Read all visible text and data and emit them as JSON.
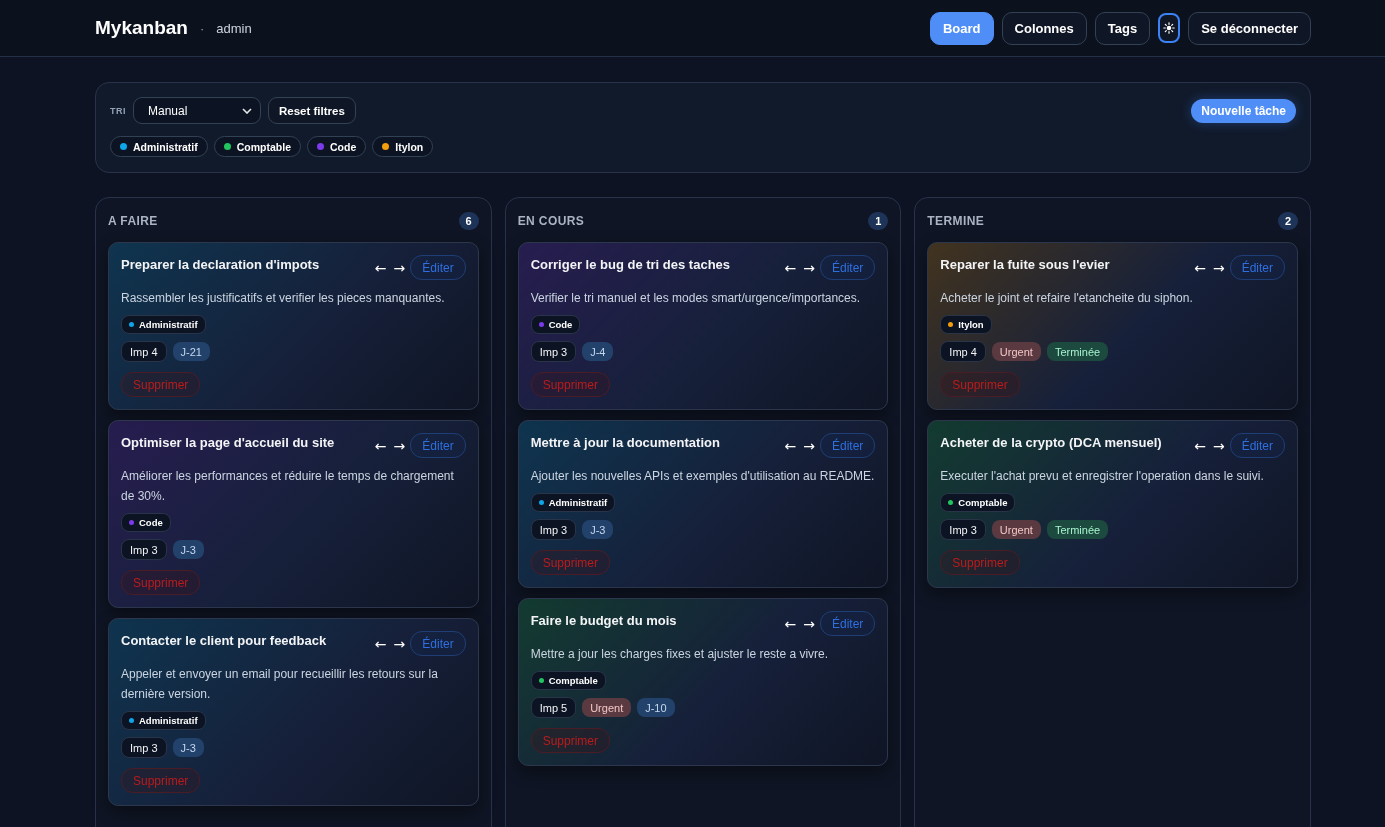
{
  "header": {
    "brand": "Mykanban",
    "separator": "·",
    "user": "admin",
    "nav": [
      {
        "label": "Board",
        "selected": true
      },
      {
        "label": "Colonnes",
        "selected": false
      },
      {
        "label": "Tags",
        "selected": false
      }
    ],
    "logout": "Se déconnecter"
  },
  "toolbar": {
    "sort_label": "TRI",
    "sort_value": "Manual",
    "reset": "Reset filtres",
    "new_task": "Nouvelle tâche",
    "tags": [
      {
        "name": "Administratif",
        "color": "#0ea5e9"
      },
      {
        "name": "Comptable",
        "color": "#22c55e"
      },
      {
        "name": "Code",
        "color": "#7c3aed"
      },
      {
        "name": "Itylon",
        "color": "#f59e0b"
      }
    ]
  },
  "columns": [
    {
      "title": "A FAIRE",
      "count": "6",
      "cards": [
        {
          "title": "Preparer la declaration d'impots",
          "description": "Rassembler les justificatifs et verifier les pieces manquantes.",
          "tag": {
            "name": "Administratif",
            "color": "#0ea5e9"
          },
          "badges": [
            {
              "kind": "imp",
              "text": "Imp 4"
            },
            {
              "kind": "due",
              "text": "J-21"
            }
          ],
          "left": "←",
          "right": "→",
          "edit": "Éditer",
          "delete": "Supprimer"
        },
        {
          "title": "Optimiser la page d'accueil du site",
          "description": "Améliorer les performances et réduire le temps de chargement de 30%.",
          "tag": {
            "name": "Code",
            "color": "#7c3aed"
          },
          "badges": [
            {
              "kind": "imp",
              "text": "Imp 3"
            },
            {
              "kind": "due",
              "text": "J-3"
            }
          ],
          "left": "←",
          "right": "→",
          "edit": "Éditer",
          "delete": "Supprimer"
        },
        {
          "title": "Contacter le client pour feedback",
          "description": "Appeler et envoyer un email pour recueillir les retours sur la dernière version.",
          "tag": {
            "name": "Administratif",
            "color": "#0ea5e9"
          },
          "badges": [
            {
              "kind": "imp",
              "text": "Imp 3"
            },
            {
              "kind": "due",
              "text": "J-3"
            }
          ],
          "left": "←",
          "right": "→",
          "edit": "Éditer",
          "delete": "Supprimer"
        }
      ]
    },
    {
      "title": "EN COURS",
      "count": "1",
      "cards": [
        {
          "title": "Corriger le bug de tri des taches",
          "description": "Verifier le tri manuel et les modes smart/urgence/importances.",
          "tag": {
            "name": "Code",
            "color": "#7c3aed"
          },
          "badges": [
            {
              "kind": "imp",
              "text": "Imp 3"
            },
            {
              "kind": "due",
              "text": "J-4"
            }
          ],
          "left": "←",
          "right": "→",
          "edit": "Éditer",
          "delete": "Supprimer"
        },
        {
          "title": "Mettre à jour la documentation",
          "description": "Ajouter les nouvelles APIs et exemples d'utilisation au README.",
          "tag": {
            "name": "Administratif",
            "color": "#0ea5e9"
          },
          "badges": [
            {
              "kind": "imp",
              "text": "Imp 3"
            },
            {
              "kind": "due",
              "text": "J-3"
            }
          ],
          "left": "←",
          "right": "→",
          "edit": "Éditer",
          "delete": "Supprimer"
        },
        {
          "title": "Faire le budget du mois",
          "description": "Mettre a jour les charges fixes et ajuster le reste a vivre.",
          "tag": {
            "name": "Comptable",
            "color": "#22c55e"
          },
          "badges": [
            {
              "kind": "imp",
              "text": "Imp 5"
            },
            {
              "kind": "urgent",
              "text": "Urgent"
            },
            {
              "kind": "due",
              "text": "J-10"
            }
          ],
          "left": "←",
          "right": "→",
          "edit": "Éditer",
          "delete": "Supprimer"
        }
      ]
    },
    {
      "title": "TERMINE",
      "count": "2",
      "cards": [
        {
          "title": "Reparer la fuite sous l'evier",
          "description": "Acheter le joint et refaire l'etancheite du siphon.",
          "tag": {
            "name": "Itylon",
            "color": "#f59e0b"
          },
          "badges": [
            {
              "kind": "imp",
              "text": "Imp 4"
            },
            {
              "kind": "urgent",
              "text": "Urgent"
            },
            {
              "kind": "done",
              "text": "Terminée"
            }
          ],
          "left": "←",
          "right": "→",
          "edit": "Éditer",
          "delete": "Supprimer"
        },
        {
          "title": "Acheter de la crypto (DCA mensuel)",
          "description": "Executer l'achat prevu et enregistrer l'operation dans le suivi.",
          "tag": {
            "name": "Comptable",
            "color": "#22c55e"
          },
          "badges": [
            {
              "kind": "imp",
              "text": "Imp 3"
            },
            {
              "kind": "urgent",
              "text": "Urgent"
            },
            {
              "kind": "done",
              "text": "Terminée"
            }
          ],
          "left": "←",
          "right": "→",
          "edit": "Éditer",
          "delete": "Supprimer"
        }
      ]
    }
  ]
}
